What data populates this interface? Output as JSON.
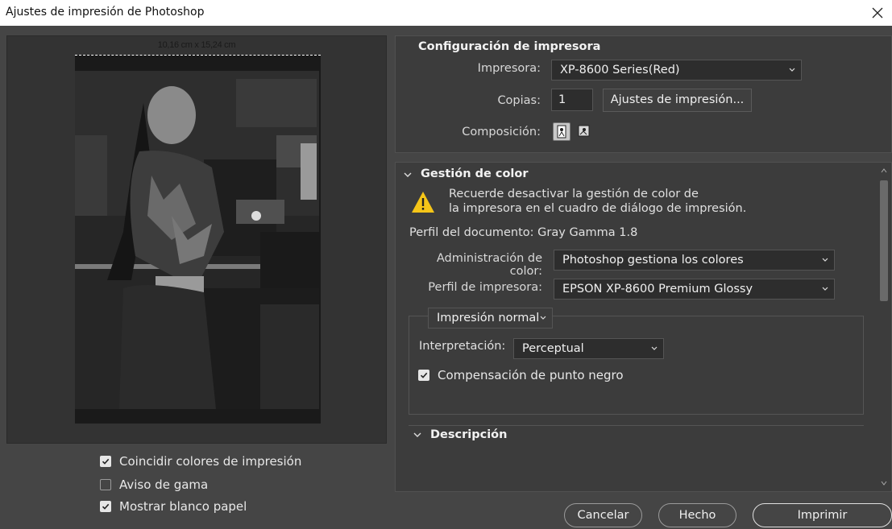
{
  "window": {
    "title": "Ajustes de impresión de Photoshop"
  },
  "preview": {
    "paper_size": "10,16 cm x 15,24 cm",
    "checkboxes": [
      {
        "label": "Coincidir colores de impresión",
        "checked": true
      },
      {
        "label": "Aviso de gama",
        "checked": false
      },
      {
        "label": "Mostrar blanco papel",
        "checked": true
      }
    ]
  },
  "printer_setup": {
    "title": "Configuración de impresora",
    "printer_label": "Impresora:",
    "printer_value": "XP-8600 Series(Red)",
    "copies_label": "Copias:",
    "copies_value": "1",
    "print_settings_button": "Ajustes de impresión...",
    "layout_label": "Composición:"
  },
  "color_management": {
    "title": "Gestión de color",
    "warning_line1": "Recuerde desactivar la gestión de color de",
    "warning_line2": "la impresora en el cuadro de diálogo de impresión.",
    "document_profile": "Perfil del documento: Gray Gamma 1.8",
    "color_handling_label": "Administración de color:",
    "color_handling_value": "Photoshop gestiona los colores",
    "printer_profile_label": "Perfil de impresora:",
    "printer_profile_value": "EPSON XP-8600 Premium Glossy",
    "print_mode_value": "Impresión normal",
    "intent_label": "Interpretación:",
    "intent_value": "Perceptual",
    "black_point_label": "Compensación de punto negro",
    "black_point_checked": true
  },
  "description": {
    "title": "Descripción"
  },
  "footer": {
    "cancel": "Cancelar",
    "done": "Hecho",
    "print": "Imprimir"
  },
  "colors": {
    "background": "#454545",
    "warning": "#f5c518"
  }
}
